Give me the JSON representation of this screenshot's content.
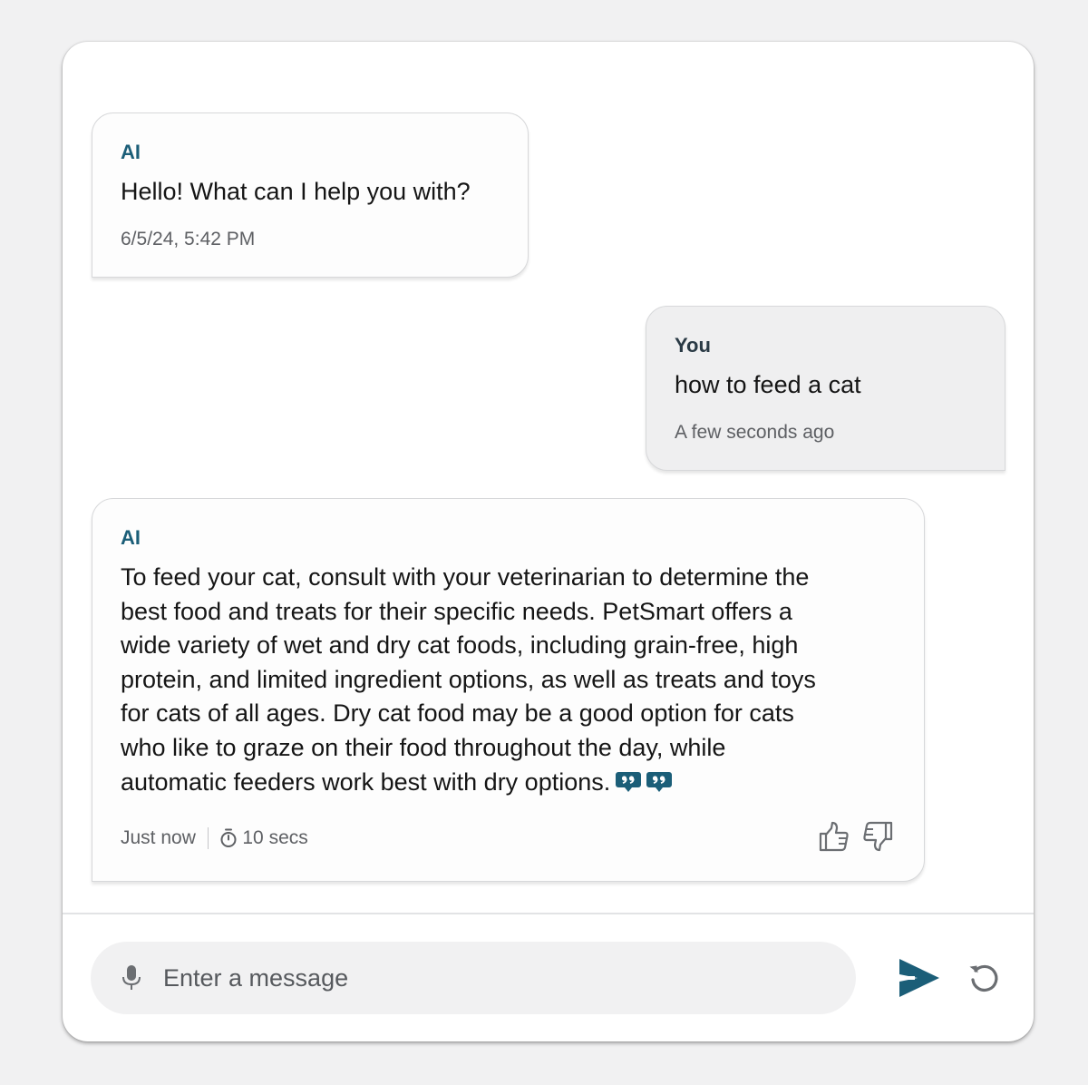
{
  "messages": [
    {
      "sender": "AI",
      "text": "Hello! What can I help you with?",
      "timestamp": "6/5/24, 5:42 PM"
    },
    {
      "sender": "You",
      "text": "how to feed a cat",
      "timestamp": "A few seconds ago"
    },
    {
      "sender": "AI",
      "text_lines": [
        "To feed your cat, consult with your veterinarian to determine the",
        "best food and treats for their specific needs. PetSmart offers a",
        "wide variety of wet and dry cat foods, including grain-free, high",
        "protein, and limited ingredient options, as well as treats and toys",
        "for cats of all ages. Dry cat food may be a good option for cats",
        "who like to graze on their food throughout the day, while",
        "automatic feeders work best with dry options."
      ],
      "citation_icons": [
        "citation-quote-icon",
        "citation-quote-icon"
      ],
      "timestamp": "Just now",
      "duration": "10 secs",
      "feedback": [
        "thumbs-up-icon",
        "thumbs-down-icon"
      ]
    }
  ],
  "composer": {
    "placeholder": "Enter a message",
    "mic_icon": "microphone-icon",
    "send_icon": "send-icon",
    "reset_icon": "restart-icon"
  },
  "colors": {
    "accent": "#1b5e78",
    "ai_bubble": "#fdfdfd",
    "user_bubble": "#efeff0",
    "page_bg": "#f1f1f2"
  }
}
